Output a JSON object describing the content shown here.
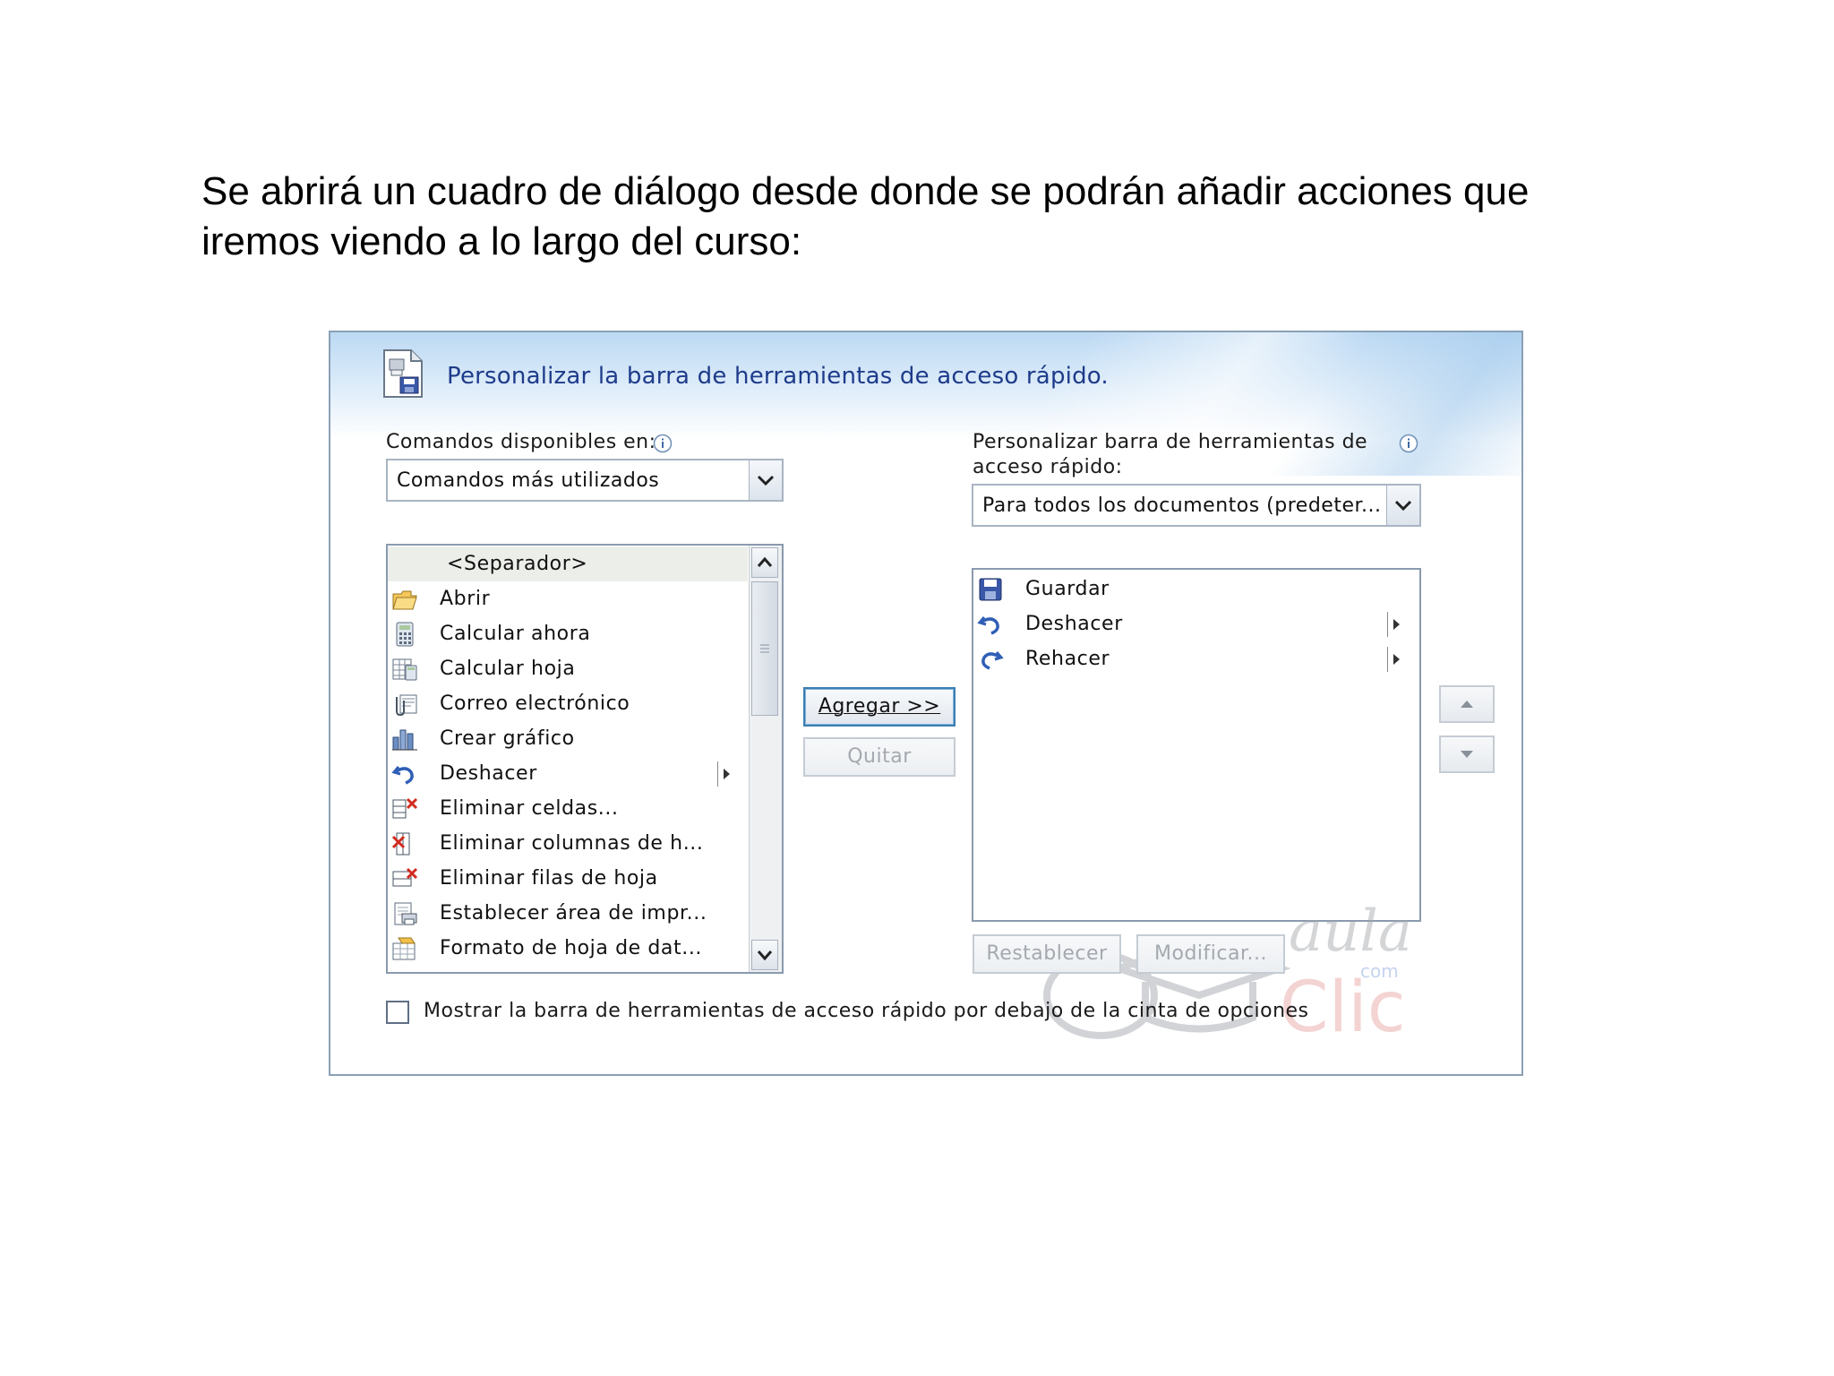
{
  "slide": {
    "line1": "Se abrirá un cuadro de diálogo desde donde se podrán añadir acciones que",
    "line2": "iremos viendo a lo largo del curso:"
  },
  "dialog": {
    "title": "Personalizar la barra de herramientas de acceso rápido.",
    "commands_label": "Comandos disponibles en:",
    "commands_value": "Comandos más utilizados",
    "custom_label_line1": "Personalizar barra de herramientas de",
    "custom_label_line2": "acceso rápido:",
    "custom_value": "Para todos los documentos (predeter...",
    "available_commands": [
      {
        "label": "<Separador>",
        "icon": "separator"
      },
      {
        "label": "Abrir",
        "icon": "folder-open-icon"
      },
      {
        "label": "Calcular ahora",
        "icon": "calculator-icon"
      },
      {
        "label": "Calcular hoja",
        "icon": "sheet-calc-icon"
      },
      {
        "label": "Correo electrónico",
        "icon": "email-attach-icon"
      },
      {
        "label": "Crear gráfico",
        "icon": "bar-chart-icon"
      },
      {
        "label": "Deshacer",
        "icon": "undo-icon"
      },
      {
        "label": "Eliminar celdas...",
        "icon": "delete-cells-icon"
      },
      {
        "label": "Eliminar columnas de h...",
        "icon": "delete-columns-icon"
      },
      {
        "label": "Eliminar filas de hoja",
        "icon": "delete-rows-icon"
      },
      {
        "label": "Establecer área de impr...",
        "icon": "print-area-icon"
      },
      {
        "label": "Formato de hoja de dat...",
        "icon": "format-sheet-icon"
      }
    ],
    "toolbar_commands": [
      {
        "label": "Guardar",
        "icon": "save-icon"
      },
      {
        "label": "Deshacer",
        "icon": "undo-icon"
      },
      {
        "label": "Rehacer",
        "icon": "redo-icon"
      }
    ],
    "add_button": "Agregar >>",
    "remove_button": "Quitar",
    "reset_button": "Restablecer",
    "modify_button": "Modificar...",
    "checkbox_label": "Mostrar la barra de herramientas de acceso rápido por debajo de la cinta de opciones",
    "checkbox_checked": false,
    "watermark": {
      "line1": "aula",
      "line2": "Clic",
      "small": "com"
    }
  }
}
